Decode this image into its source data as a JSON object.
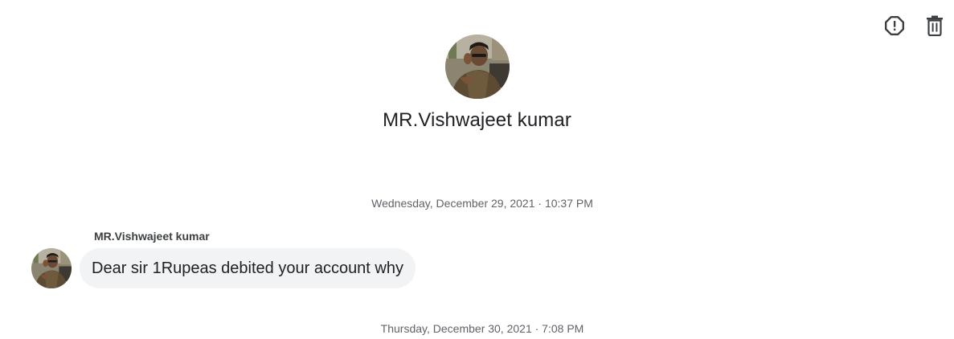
{
  "header": {
    "contact_name": "MR.Vishwajeet kumar"
  },
  "top_actions": [
    {
      "icon": "report-spam-icon"
    },
    {
      "icon": "trash-icon"
    }
  ],
  "conversation": {
    "timestamps": [
      "Wednesday, December 29, 2021 · 10:37 PM",
      "Thursday, December 30, 2021 · 7:08 PM"
    ],
    "message": {
      "sender": "MR.Vishwajeet kumar",
      "text": "Dear sir 1Rupeas debited your account why"
    }
  },
  "colors": {
    "bubble_bg": "#f1f3f4",
    "text_primary": "#202124",
    "text_secondary": "#5f6368"
  }
}
